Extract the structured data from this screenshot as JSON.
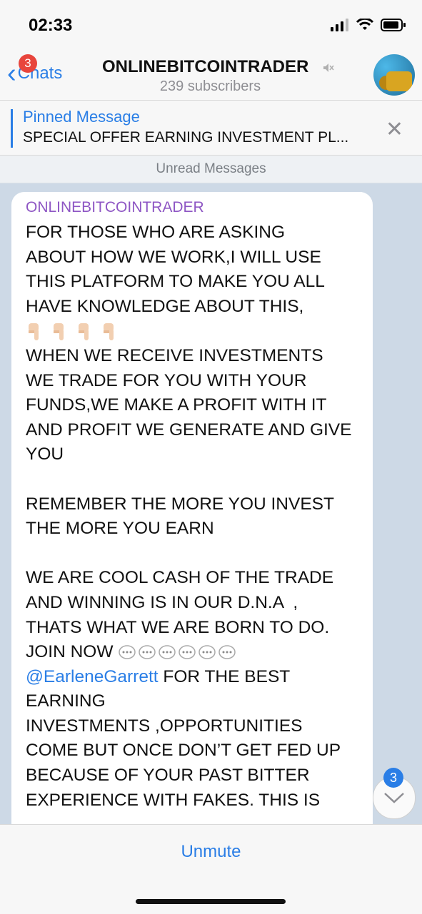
{
  "status_bar": {
    "time": "02:33"
  },
  "header": {
    "back_label": "Chats",
    "back_badge": "3",
    "title": "ONLINEBITCOINTRADER",
    "subtitle": "239 subscribers",
    "muted_icon": "speaker-muted-icon",
    "avatar_icon": "channel-avatar"
  },
  "pinned": {
    "title": "Pinned Message",
    "text": "SPECIAL OFFER EARNING INVESTMENT PL..."
  },
  "divider": {
    "label": "Unread Messages"
  },
  "message": {
    "sender": "ONLINEBITCOINTRADER",
    "part1": "FOR THOSE WHO ARE ASKING\nABOUT HOW WE WORK,I WILL USE\nTHIS PLATFORM TO MAKE YOU ALL\nHAVE KNOWLEDGE ABOUT THIS,\n",
    "part2": "WHEN WE RECEIVE INVESTMENTS\nWE TRADE FOR YOU WITH YOUR\nFUNDS,WE MAKE A PROFIT WITH IT\nAND PROFIT WE GENERATE AND GIVE\nYOU\n\nREMEMBER THE MORE YOU INVEST\nTHE MORE YOU EARN\n\nWE ARE COOL CASH OF THE TRADE\nAND WINNING IS IN OUR D.N.A  ,\nTHATS WHAT WE ARE BORN TO DO.\nJOIN NOW ",
    "mention": "@EarleneGarrett",
    "part3": " FOR THE BEST\nEARNING\nINVESTMENTS ,OPPORTUNITIES\nCOME BUT ONCE DON’T GET FED UP\nBECAUSE OF YOUR PAST BITTER\nEXPERIENCE WITH FAKES. THIS IS"
  },
  "scroll_down": {
    "badge": "3"
  },
  "bottom": {
    "unmute_label": "Unmute"
  },
  "colors": {
    "accent": "#2a7ee6",
    "sender": "#8e56c4",
    "chat_bg": "#cdd9e6",
    "badge_red": "#e8453c"
  }
}
